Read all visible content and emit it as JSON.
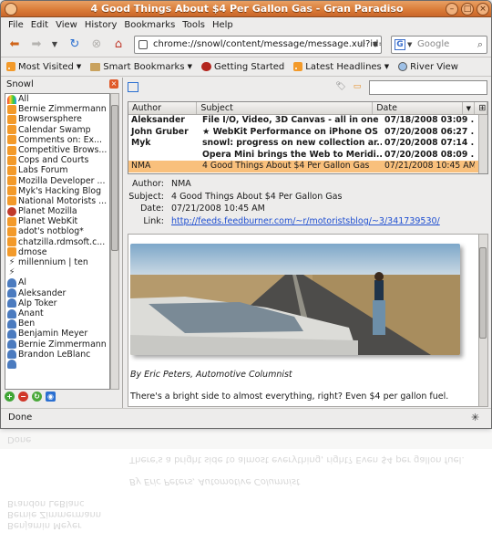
{
  "window": {
    "title": "4 Good Things About $4 Per Gallon Gas - Gran Paradiso"
  },
  "menu": [
    "File",
    "Edit",
    "View",
    "History",
    "Bookmarks",
    "Tools",
    "Help"
  ],
  "nav": {
    "url": "chrome://snowl/content/message/message.xul?id=",
    "search_placeholder": "Google"
  },
  "bookmarks": [
    {
      "label": "Most Visited",
      "icon": "rss-icon",
      "dropdown": true
    },
    {
      "label": "Smart Bookmarks",
      "icon": "folder-icon",
      "dropdown": true
    },
    {
      "label": "Getting Started",
      "icon": "getting-started-icon",
      "dropdown": false
    },
    {
      "label": "Latest Headlines",
      "icon": "rss-icon",
      "dropdown": true
    },
    {
      "label": "River View",
      "icon": "river-view-icon",
      "dropdown": false
    }
  ],
  "sidebar": {
    "title": "Snowl",
    "items": [
      {
        "label": "All",
        "icon": "rainbow"
      },
      {
        "label": "Bernie Zimmermann",
        "icon": "rss"
      },
      {
        "label": "Browsersphere",
        "icon": "rss"
      },
      {
        "label": "Calendar Swamp",
        "icon": "rss"
      },
      {
        "label": "Comments on: Ex...",
        "icon": "rss"
      },
      {
        "label": "Competitive Brows...",
        "icon": "rss"
      },
      {
        "label": "Cops and Courts",
        "icon": "rss"
      },
      {
        "label": "Labs Forum",
        "icon": "rss"
      },
      {
        "label": "Mozilla Developer ...",
        "icon": "rss"
      },
      {
        "label": "Myk's Hacking Blog",
        "icon": "rss"
      },
      {
        "label": "National Motorists ...",
        "icon": "rss"
      },
      {
        "label": "Planet Mozilla",
        "icon": "mozilla"
      },
      {
        "label": "Planet WebKit",
        "icon": "rss"
      },
      {
        "label": "adot's notblog*",
        "icon": "rss"
      },
      {
        "label": "chatzilla.rdmsoft.c...",
        "icon": "rss"
      },
      {
        "label": "dmose",
        "icon": "rss"
      },
      {
        "label": "millennium | ten",
        "icon": "bolt"
      },
      {
        "label": "",
        "icon": "bolt"
      },
      {
        "label": "Al",
        "icon": "person"
      },
      {
        "label": "Aleksander",
        "icon": "person"
      },
      {
        "label": "Alp Toker",
        "icon": "person"
      },
      {
        "label": "Anant",
        "icon": "person"
      },
      {
        "label": "Ben",
        "icon": "person"
      },
      {
        "label": "Benjamin Meyer",
        "icon": "person"
      },
      {
        "label": "Bernie Zimmermann",
        "icon": "person"
      },
      {
        "label": "Brandon LeBlanc",
        "icon": "person"
      },
      {
        "label": "",
        "icon": "person"
      }
    ]
  },
  "messages": {
    "columns": [
      "Author",
      "Subject",
      "Date"
    ],
    "rows": [
      {
        "author": "Aleksander",
        "subject": "File I/O, Video, 3D Canvas - all in one ...",
        "date": "07/18/2008 03:09 ...",
        "bold": true,
        "selected": false
      },
      {
        "author": "John Gruber",
        "subject": "★ WebKit Performance on iPhone OS ...",
        "date": "07/20/2008 06:27 ...",
        "bold": true,
        "selected": false
      },
      {
        "author": "Myk",
        "subject": "snowl: progress on new collection ar...",
        "date": "07/20/2008 07:14 ...",
        "bold": true,
        "selected": false
      },
      {
        "author": "",
        "subject": "Opera Mini brings the Web to Meridi...",
        "date": "07/20/2008 08:09 ...",
        "bold": true,
        "selected": false
      },
      {
        "author": "NMA",
        "subject": "4 Good Things About $4 Per Gallon Gas",
        "date": "07/21/2008 10:45 AM",
        "bold": false,
        "selected": true
      }
    ]
  },
  "message": {
    "author_label": "Author:",
    "author": "NMA",
    "subject_label": "Subject:",
    "subject": "4 Good Things About $4 Per Gallon Gas",
    "date_label": "Date:",
    "date": "07/21/2008 10:45 AM",
    "link_label": "Link:",
    "link": "http://feeds.feedburner.com/~r/motoristsblog/~3/341739530/",
    "caption": "By Eric Peters, Automotive Columnist",
    "body": "There's a bright side to almost everything, right? Even $4 per gallon fuel."
  },
  "status": {
    "text": "Done"
  },
  "colors": {
    "titlebar": "#d97a36",
    "selection": "#f9c07c",
    "link": "#1f4fd1"
  }
}
